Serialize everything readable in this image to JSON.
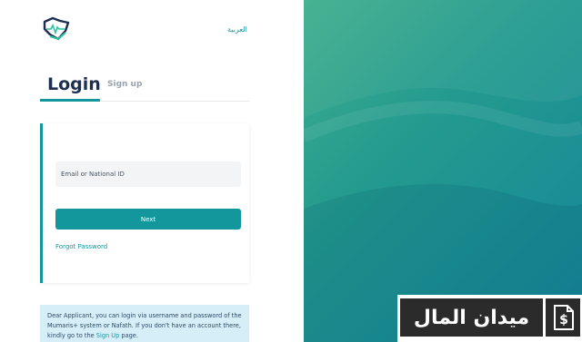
{
  "header": {
    "language_toggle": "العربية"
  },
  "tabs": {
    "login": "Login",
    "signup": "Sign up"
  },
  "form": {
    "id_placeholder": "Email or National ID",
    "next_label": "Next",
    "forgot_label": "Forgot Password"
  },
  "notice": {
    "text_before": "Dear Applicant, you can login via username and password of the Mumaris+ system or Nafath. If you don't have an account there, kindly go to the ",
    "link": "Sign Up",
    "text_after": " page."
  },
  "watermark": {
    "text": "ميدان المال",
    "icon": "dollar-doc-icon"
  },
  "colors": {
    "accent": "#14979c",
    "title": "#1c2f4f",
    "notice_bg": "#d6eef8"
  }
}
